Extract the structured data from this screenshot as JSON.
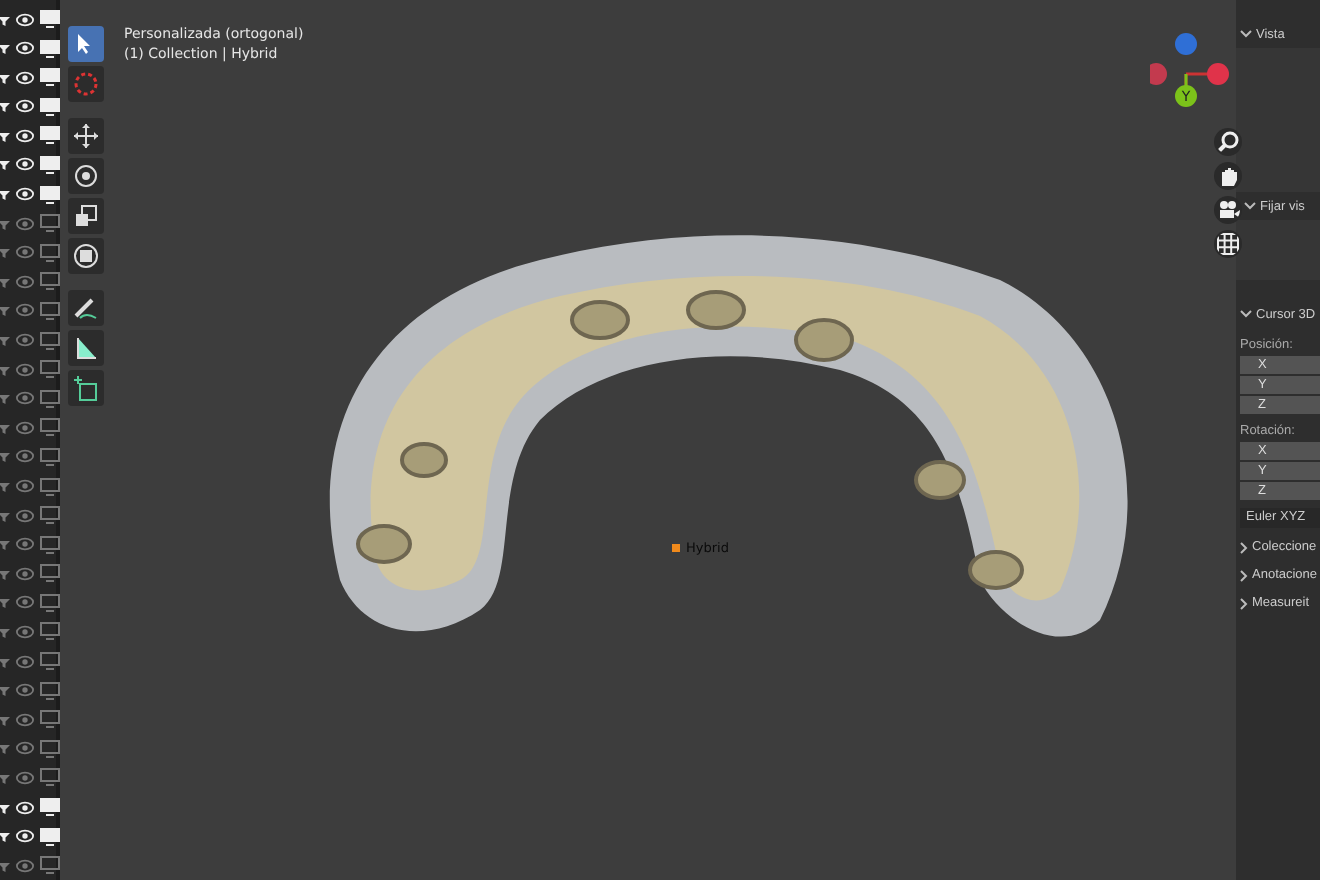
{
  "outliner": {
    "rows": [
      {
        "active": true
      },
      {
        "active": true
      },
      {
        "active": true
      },
      {
        "active": true
      },
      {
        "active": true
      },
      {
        "active": true
      },
      {
        "active": true
      },
      {
        "active": false
      },
      {
        "active": false
      },
      {
        "active": false
      },
      {
        "active": false
      },
      {
        "active": false
      },
      {
        "active": false
      },
      {
        "active": false
      },
      {
        "active": false
      },
      {
        "active": false
      },
      {
        "active": false
      },
      {
        "active": false
      },
      {
        "active": false
      },
      {
        "active": false
      },
      {
        "active": false
      },
      {
        "active": false
      },
      {
        "active": false
      },
      {
        "active": false
      },
      {
        "active": false
      },
      {
        "active": false
      },
      {
        "active": false
      },
      {
        "active": true
      },
      {
        "active": true
      },
      {
        "active": false
      }
    ]
  },
  "toolbar": {
    "tools": [
      {
        "kind": "select",
        "selected": true
      },
      {
        "kind": "cursor",
        "selected": false
      },
      {
        "kind": "move",
        "selected": false
      },
      {
        "kind": "rotate",
        "selected": false
      },
      {
        "kind": "scale",
        "selected": false
      },
      {
        "kind": "transform",
        "selected": false
      },
      {
        "kind": "annotate",
        "selected": false
      },
      {
        "kind": "measure",
        "selected": false
      },
      {
        "kind": "add",
        "selected": false
      }
    ]
  },
  "viewport": {
    "view_name": "Personalizada (ortogonal)",
    "collection_info": "(1) Collection | Hybrid",
    "object_label": "Hybrid"
  },
  "gizmo": {
    "axes": [
      {
        "color": "#2f6fd6"
      },
      {
        "color": "#c33a4e"
      },
      {
        "color": "#e0334a"
      },
      {
        "label": "Y",
        "color": "#7cc21a"
      }
    ]
  },
  "sidebar": {
    "vista_header": "Vista",
    "fijar_header": "Fijar vis",
    "cursor_header": "Cursor 3D",
    "position_label": "Posición:",
    "position_fields": [
      "X",
      "Y",
      "Z"
    ],
    "rotation_label": "Rotación:",
    "rotation_fields": [
      "X",
      "Y",
      "Z"
    ],
    "rotation_mode": "Euler XYZ",
    "sections": [
      "Coleccione",
      "Anotacione",
      "Measureit"
    ]
  }
}
